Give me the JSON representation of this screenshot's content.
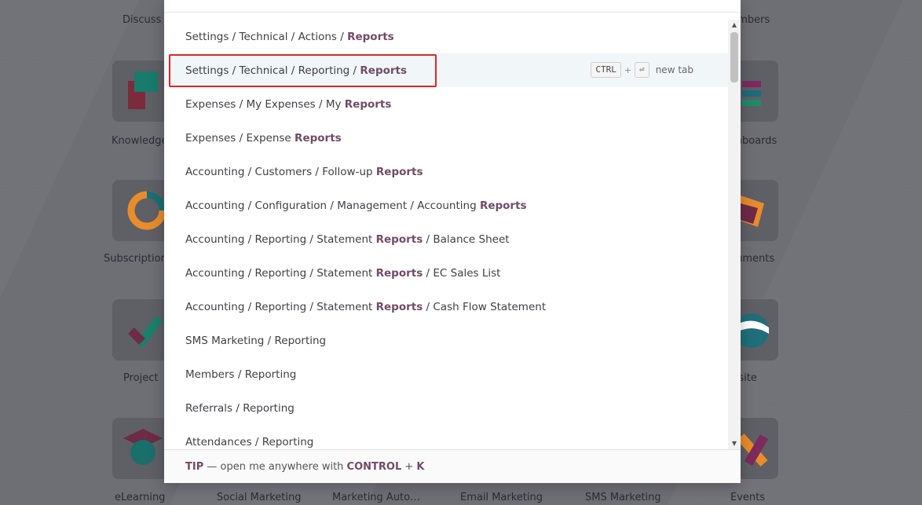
{
  "background_apps": [
    {
      "label": "Discuss"
    },
    {
      "label": "Knowledge"
    },
    {
      "label": "Subscriptions"
    },
    {
      "label": "Project"
    },
    {
      "label": "eLearning"
    },
    {
      "label": "Social Marketing"
    },
    {
      "label": "Marketing Auto…"
    },
    {
      "label": "Email Marketing"
    },
    {
      "label": "SMS Marketing"
    },
    {
      "label": "Events"
    },
    {
      "label": "Members"
    },
    {
      "label": "Dashboards"
    },
    {
      "label": "Documents"
    },
    {
      "label": "Website"
    }
  ],
  "results": [
    {
      "prefix": "Settings / Technical / Actions / ",
      "match": "Reports",
      "suffix": ""
    },
    {
      "prefix": "Settings / Technical / Reporting / ",
      "match": "Reports",
      "suffix": ""
    },
    {
      "prefix": "Expenses / My Expenses / My ",
      "match": "Reports",
      "suffix": ""
    },
    {
      "prefix": "Expenses / Expense ",
      "match": "Reports",
      "suffix": ""
    },
    {
      "prefix": "Accounting / Customers / Follow-up ",
      "match": "Reports",
      "suffix": ""
    },
    {
      "prefix": "Accounting / Configuration / Management / Accounting ",
      "match": "Reports",
      "suffix": ""
    },
    {
      "prefix": "Accounting / Reporting / Statement ",
      "match": "Reports",
      "suffix": " / Balance Sheet"
    },
    {
      "prefix": "Accounting / Reporting / Statement ",
      "match": "Reports",
      "suffix": " / EC Sales List"
    },
    {
      "prefix": "Accounting / Reporting / Statement ",
      "match": "Reports",
      "suffix": " / Cash Flow Statement"
    },
    {
      "prefix": "SMS Marketing / Reporting",
      "match": "",
      "suffix": ""
    },
    {
      "prefix": "Members / Reporting",
      "match": "",
      "suffix": ""
    },
    {
      "prefix": "Referrals / Reporting",
      "match": "",
      "suffix": ""
    },
    {
      "prefix": "Attendances / Reporting",
      "match": "",
      "suffix": ""
    }
  ],
  "focused_hint": {
    "key1": "CTRL",
    "plus": "+",
    "key2": "⏎",
    "label": "new tab"
  },
  "footer": {
    "tip": "TIP",
    "text": " — open me anywhere with ",
    "key1": "CONTROL",
    "plus": " + ",
    "key2": "K"
  },
  "colors": {
    "highlight": "#714b67",
    "selection_border": "#e0262a"
  },
  "icons": {
    "scroll_up": "triangle-up-icon",
    "scroll_down": "triangle-down-icon"
  }
}
